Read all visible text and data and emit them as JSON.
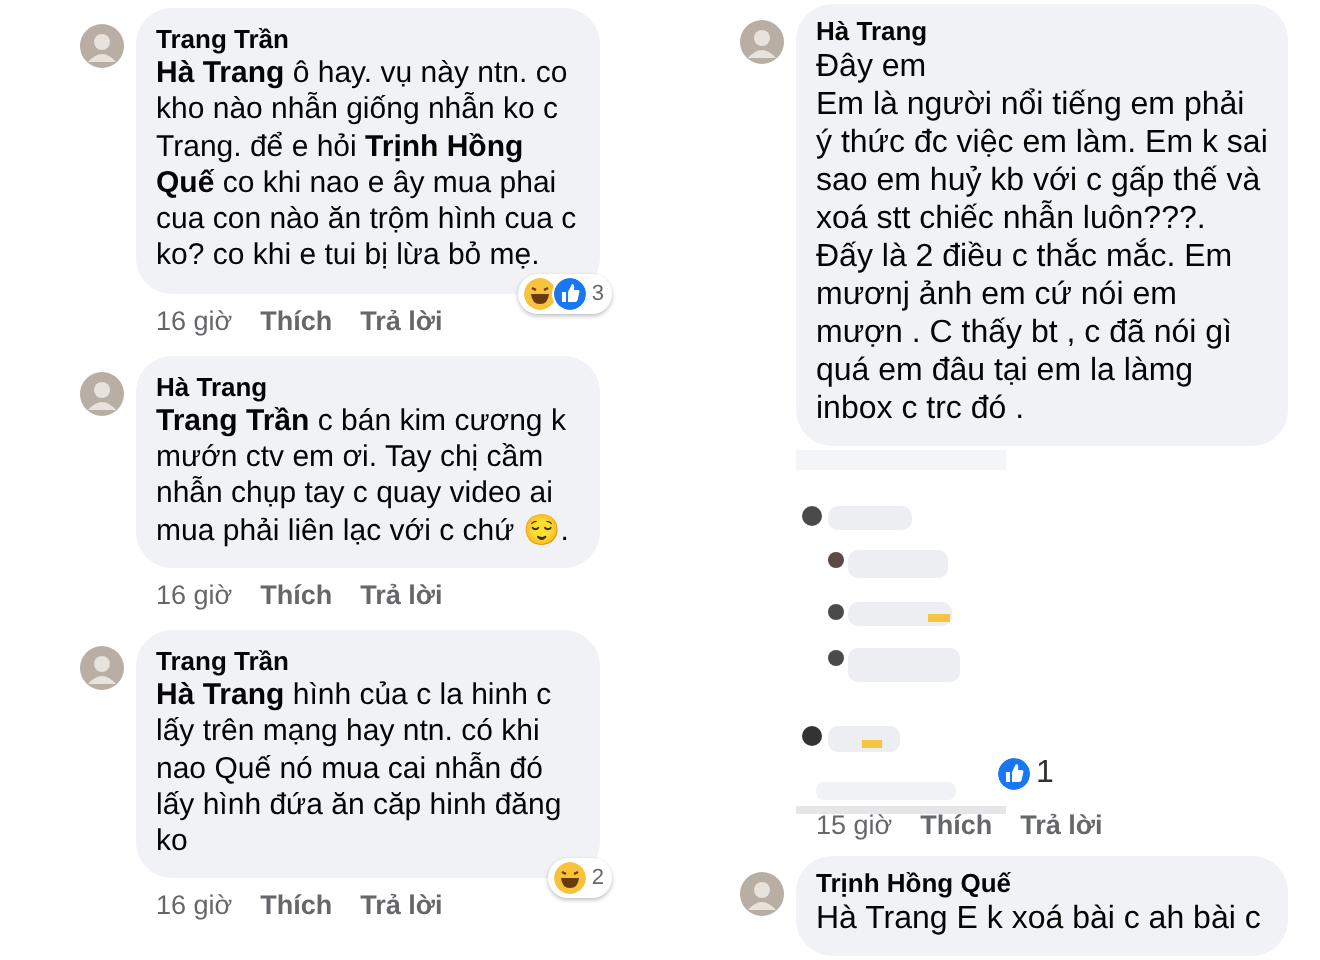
{
  "columns": [
    {
      "comments": [
        {
          "author": "Trang Trần",
          "text": "**Hà Trang** ô hay. vụ này ntn. co kho nào nhẫn giống nhẫn ko c Trang. để e hỏi **Trịnh Hồng Quế** co khi nao e ây mua phai cua con nào ăn trộm hình cua c ko?  co khi e tui bị lừa bỏ mẹ.",
          "time": "16 giờ",
          "like_label": "Thích",
          "reply_label": "Trả lời",
          "reactions": {
            "items": [
              {
                "kind": "haha"
              },
              {
                "kind": "like"
              }
            ],
            "count": "3"
          }
        },
        {
          "author": "Hà Trang",
          "text": "**Trang Trần** c bán kim cương k mướn ctv em ơi. Tay chị cầm nhẫn chụp tay c quay video ai mua phải liên lạc với c chứ 😌.",
          "time": "16 giờ",
          "like_label": "Thích",
          "reply_label": "Trả lời"
        },
        {
          "author": "Trang Trần",
          "text": "**Hà Trang**  hình của c la hinh c lấy trên mạng hay ntn. có khi nao Quế nó mua cai nhẫn đó lấy hình đứa ăn căp hinh đăng ko",
          "time": "16 giờ",
          "like_label": "Thích",
          "reply_label": "Trả lời",
          "reactions": {
            "items": [
              {
                "kind": "haha"
              }
            ],
            "count": "2"
          }
        }
      ]
    },
    {
      "comments": [
        {
          "author": "Hà Trang",
          "text": "Đây em\nEm là người nổi tiếng em phải ý thức đc việc em làm. Em k sai sao em huỷ kb với c gấp thế và xoá stt chiếc nhẫn luôn???. Đấy là 2 điều c thắc mắc. Em mươnj  ảnh em cứ nói em mượn . C thấy bt , c đã nói gì quá em đâu tại em la làmg inbox c trc đó .",
          "attachment": {
            "kind": "picture",
            "reactions": {
              "items": [
                {
                  "kind": "like"
                }
              ],
              "count": "1"
            }
          },
          "time": "15 giờ",
          "like_label": "Thích",
          "reply_label": "Trả lời"
        },
        {
          "author": "Trịnh Hồng Quế",
          "text": "Hà Trang E k xoá bài c ah bài c"
        }
      ]
    }
  ]
}
